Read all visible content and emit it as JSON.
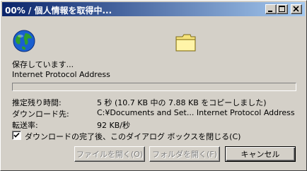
{
  "window": {
    "title": "00% / 個人情報を取得中..."
  },
  "status": {
    "message": "保存しています...",
    "item_name": "Internet Protocol Address",
    "progress_fraction": 0.0
  },
  "details": [
    {
      "label": "推定残り時間:",
      "value": "5 秒 (10.7 KB 中の 7.88 KB をコピーしました)"
    },
    {
      "label": "ダウンロード先:",
      "value": "C:¥Documents and Set... Internet Protocol Address"
    },
    {
      "label": "転送率:",
      "value": "92 KB/秒"
    }
  ],
  "options": {
    "close_on_complete_label": "ダウンロードの完了後、このダイアログ ボックスを閉じる(C)",
    "close_on_complete_checked": true
  },
  "buttons": {
    "open_file": "ファイルを開く(O)",
    "open_folder": "フォルダを開く(F)",
    "cancel": "キャンセル"
  },
  "icons": {
    "title_minimize": "minimize-icon",
    "title_maximize": "maximize-icon",
    "title_close": "close-icon",
    "source": "globe-icon",
    "destination": "folder-icon"
  }
}
